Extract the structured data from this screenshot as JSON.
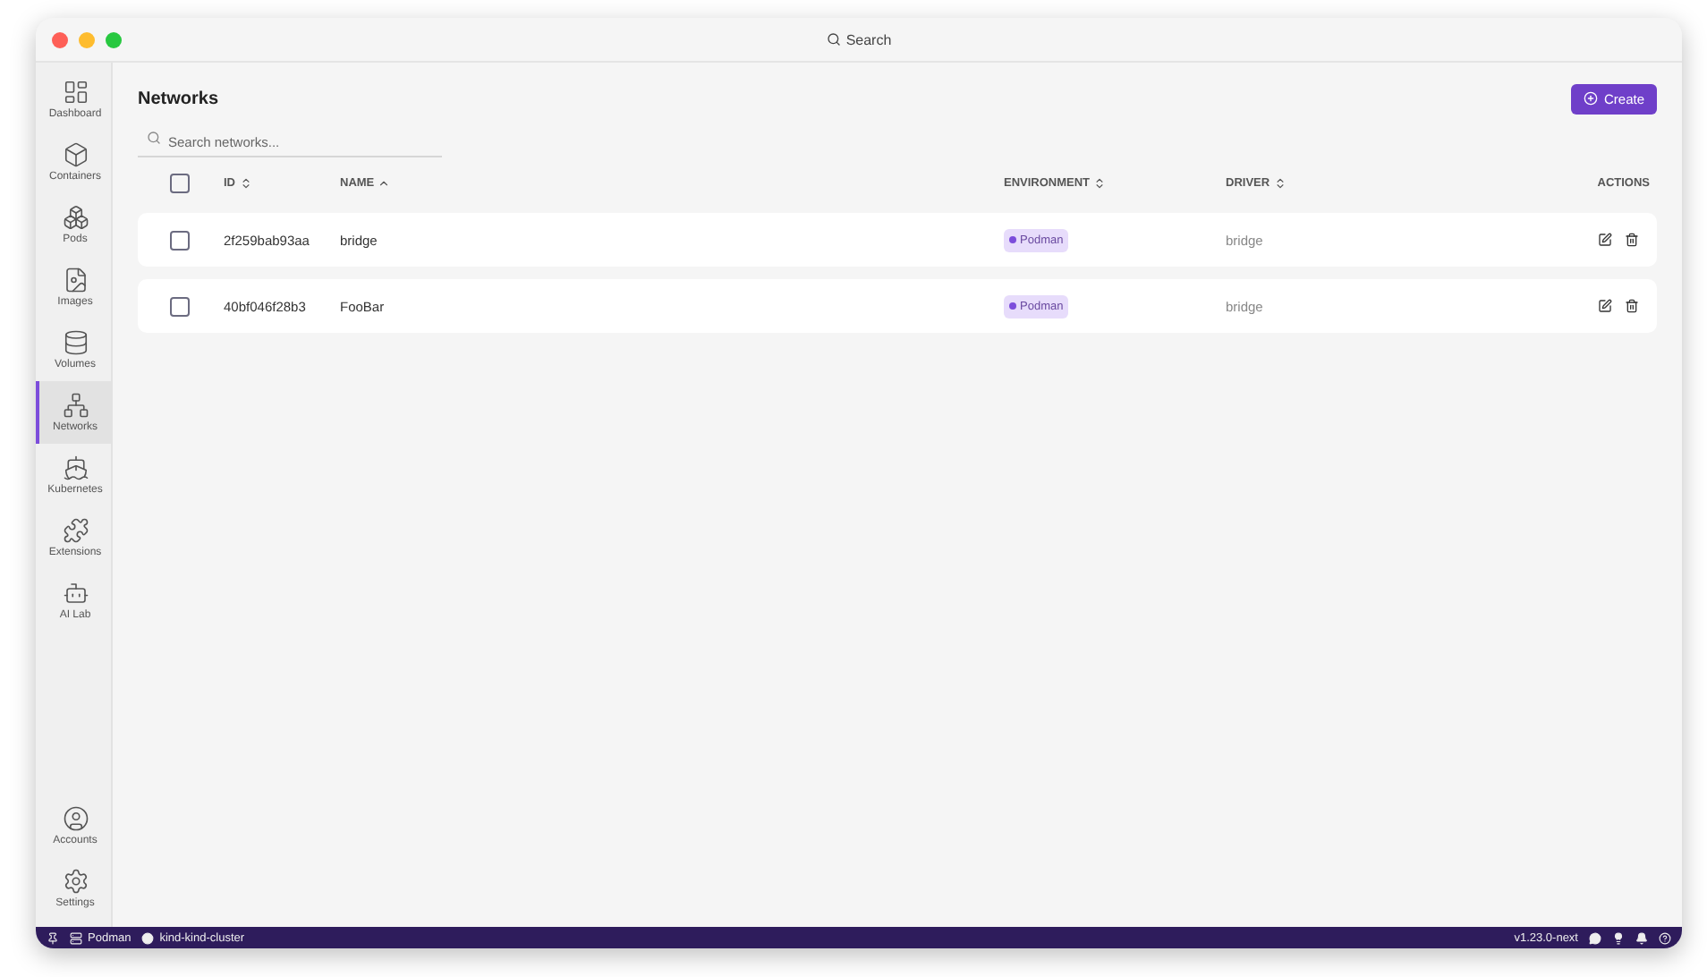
{
  "window": {
    "search": "Search"
  },
  "sidebar": {
    "items": [
      {
        "label": "Dashboard",
        "selected": false
      },
      {
        "label": "Containers",
        "selected": false
      },
      {
        "label": "Pods",
        "selected": false
      },
      {
        "label": "Images",
        "selected": false
      },
      {
        "label": "Volumes",
        "selected": false
      },
      {
        "label": "Networks",
        "selected": true
      },
      {
        "label": "Kubernetes",
        "selected": false
      },
      {
        "label": "Extensions",
        "selected": false
      },
      {
        "label": "AI Lab",
        "selected": false
      }
    ],
    "bottom": [
      {
        "label": "Accounts"
      },
      {
        "label": "Settings"
      }
    ]
  },
  "page": {
    "title": "Networks",
    "create_button": "Create",
    "search": {
      "placeholder": "Search networks..."
    }
  },
  "table": {
    "select_all": {
      "checked": false
    },
    "columns": [
      {
        "label": "ID",
        "sortable": true,
        "sorted": false
      },
      {
        "label": "NAME",
        "sortable": true,
        "sorted": true
      },
      {
        "label": "ENVIRONMENT",
        "sortable": true,
        "sorted": false
      },
      {
        "label": "DRIVER",
        "sortable": true,
        "sorted": false
      },
      {
        "label": "ACTIONS",
        "sortable": false
      }
    ],
    "rows": [
      {
        "checked": false,
        "id": "2f259bab93aa",
        "name": "bridge",
        "environment": "Podman",
        "driver": "bridge"
      },
      {
        "checked": false,
        "id": "40bf046f28b3",
        "name": "FooBar",
        "environment": "Podman",
        "driver": "bridge"
      }
    ]
  },
  "status_bar": {
    "engine": "Podman",
    "context": "kind-kind-cluster",
    "version": "v1.23.0-next"
  }
}
